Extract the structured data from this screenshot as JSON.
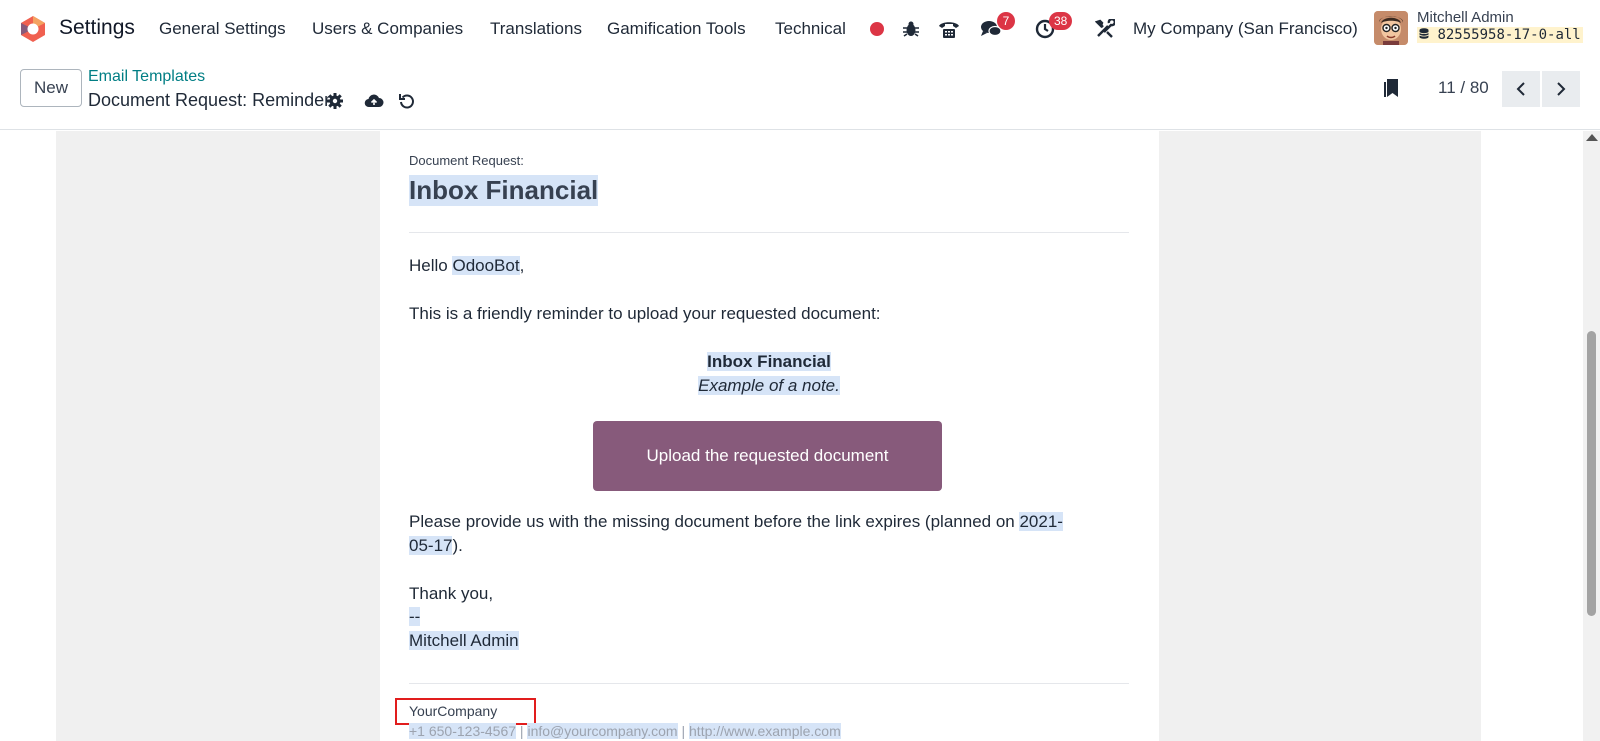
{
  "navbar": {
    "app_name": "Settings",
    "menu": [
      "General Settings",
      "Users & Companies",
      "Translations",
      "Gamification Tools",
      "Technical"
    ],
    "messages_count": "7",
    "activities_count": "38",
    "company": "My Company (San Francisco)",
    "user_name": "Mitchell Admin",
    "database": "82555958-17-0-all"
  },
  "control_panel": {
    "new_label": "New",
    "breadcrumb": "Email Templates",
    "record_title": "Document Request: Reminder",
    "pager": "11 / 80"
  },
  "mail": {
    "request_label": "Document Request:",
    "title": "Inbox Financial",
    "greeting_prefix": "Hello ",
    "greeting_name": "OdooBot",
    "greeting_suffix": ",",
    "reminder_text": "This is a friendly reminder to upload your requested document:",
    "document_name": "Inbox Financial",
    "document_note": "Example of a note.",
    "upload_button": "Upload the requested document",
    "expiry_prefix": "Please provide us with the missing document before the link expires (planned on ",
    "expiry_date_part1": "2021-",
    "expiry_date_part2": "05-17",
    "expiry_suffix": ").",
    "thanks": "Thank you,",
    "signature_sep": "--",
    "signature_name": "Mitchell Admin",
    "company_name": "YourCompany",
    "phone": "+1 650-123-4567",
    "email": "info@yourcompany.com",
    "website": "http://www.example.com",
    "separator": " | "
  },
  "colors": {
    "accent": "#017e84",
    "button": "#875a7b",
    "highlight": "#d6e4f7",
    "badge": "#dc3545",
    "annotation_box": "#e11d1d"
  }
}
